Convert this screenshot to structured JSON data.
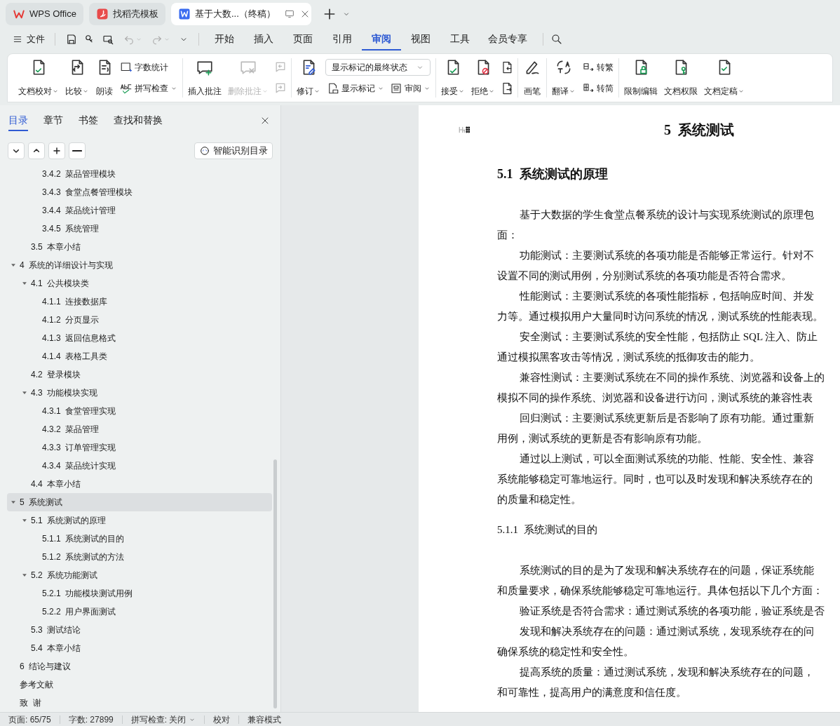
{
  "browser_tabs": [
    {
      "label": "WPS Office",
      "selected": false
    },
    {
      "label": "找稻壳模板",
      "selected": false
    },
    {
      "label": "基于大数...（终稿）",
      "selected": true
    }
  ],
  "file_menu": "文件",
  "menu_tabs": [
    {
      "label": "开始",
      "selected": false
    },
    {
      "label": "插入",
      "selected": false
    },
    {
      "label": "页面",
      "selected": false
    },
    {
      "label": "引用",
      "selected": false
    },
    {
      "label": "审阅",
      "selected": true
    },
    {
      "label": "视图",
      "selected": false
    },
    {
      "label": "工具",
      "selected": false
    },
    {
      "label": "会员专享",
      "selected": false
    }
  ],
  "ribbon": [
    {
      "items": [
        {
          "kind": "big",
          "label": "文档校对",
          "dropdown": true,
          "disabled": false
        },
        {
          "kind": "big",
          "label": "比较",
          "dropdown": true,
          "disabled": false
        },
        {
          "kind": "big",
          "label": "朗读",
          "dropdown": false,
          "disabled": false
        },
        {
          "kind": "stack",
          "rows": [
            [
              {
                "kind": "small",
                "label": "字数统计",
                "dropdown": false,
                "disabled": false
              }
            ],
            [
              {
                "kind": "small",
                "label": "拼写检查",
                "dropdown": true,
                "disabled": false
              }
            ]
          ]
        }
      ]
    },
    {
      "items": [
        {
          "kind": "big",
          "label": "插入批注",
          "dropdown": false,
          "disabled": false
        },
        {
          "kind": "big",
          "label": "删除批注",
          "dropdown": true,
          "disabled": true
        },
        {
          "kind": "stack",
          "rows": [
            [
              {
                "kind": "icon",
                "disabled": true
              }
            ],
            [
              {
                "kind": "icon",
                "disabled": true
              }
            ]
          ]
        }
      ]
    },
    {
      "items": [
        {
          "kind": "big",
          "label": "修订",
          "dropdown": true,
          "disabled": false
        },
        {
          "kind": "stack",
          "rows": [
            [
              {
                "kind": "select",
                "value": "显示标记的最终状态"
              }
            ],
            [
              {
                "kind": "small",
                "label": "显示标记",
                "dropdown": true,
                "disabled": false
              },
              {
                "kind": "small",
                "label": "审阅",
                "dropdown": true,
                "disabled": false
              }
            ]
          ]
        }
      ]
    },
    {
      "items": [
        {
          "kind": "big",
          "label": "接受",
          "dropdown": true,
          "disabled": false
        },
        {
          "kind": "big",
          "label": "拒绝",
          "dropdown": true,
          "disabled": false
        },
        {
          "kind": "stack",
          "rows": [
            [
              {
                "kind": "icon",
                "disabled": false
              }
            ],
            [
              {
                "kind": "icon",
                "disabled": false
              }
            ]
          ]
        }
      ]
    },
    {
      "items": [
        {
          "kind": "big",
          "label": "画笔",
          "dropdown": false,
          "disabled": false
        }
      ]
    },
    {
      "items": [
        {
          "kind": "big",
          "label": "翻译",
          "dropdown": true,
          "disabled": false
        },
        {
          "kind": "stack",
          "rows": [
            [
              {
                "kind": "small",
                "label": "转繁",
                "dropdown": false,
                "disabled": false
              }
            ],
            [
              {
                "kind": "small",
                "label": "转简",
                "dropdown": false,
                "disabled": false
              }
            ]
          ]
        }
      ]
    },
    {
      "items": [
        {
          "kind": "big",
          "label": "限制编辑",
          "dropdown": false,
          "disabled": false
        },
        {
          "kind": "big",
          "label": "文档权限",
          "dropdown": false,
          "disabled": false
        },
        {
          "kind": "big",
          "label": "文档定稿",
          "dropdown": true,
          "disabled": false
        }
      ]
    }
  ],
  "sidebar": {
    "tabs": [
      {
        "label": "目录",
        "selected": true
      },
      {
        "label": "章节",
        "selected": false
      },
      {
        "label": "书签",
        "selected": false
      },
      {
        "label": "查找和替换",
        "selected": false
      }
    ],
    "smart_button": "智能识别目录",
    "toc": [
      {
        "children": [
          {
            "children": [
              {
                "label": "3.4.2  菜品管理模块",
                "selected": false
              },
              {
                "label": "3.4.3  食堂点餐管理模块",
                "selected": false
              },
              {
                "label": "3.4.4  菜品统计管理",
                "selected": false
              },
              {
                "label": "3.4.5  系统管理",
                "selected": false
              }
            ]
          },
          {
            "label": "3.5  本章小结",
            "selected": false
          }
        ]
      },
      {
        "label": "4  系统的详细设计与实现",
        "selected": false,
        "expanded": true,
        "children": [
          {
            "label": "4.1  公共模块类",
            "selected": false,
            "expanded": true,
            "children": [
              {
                "label": "4.1.1  连接数据库",
                "selected": false
              },
              {
                "label": "4.1.2  分页显示",
                "selected": false
              },
              {
                "label": "4.1.3  返回信息格式",
                "selected": false
              },
              {
                "label": "4.1.4  表格工具类",
                "selected": false
              }
            ]
          },
          {
            "label": "4.2  登录模块",
            "selected": false
          },
          {
            "label": "4.3  功能模块实现",
            "selected": false,
            "expanded": true,
            "children": [
              {
                "label": "4.3.1  食堂管理实现",
                "selected": false
              },
              {
                "label": "4.3.2  菜品管理",
                "selected": false
              },
              {
                "label": "4.3.3  订单管理实现",
                "selected": false
              },
              {
                "label": "4.3.4  菜品统计实现",
                "selected": false
              }
            ]
          },
          {
            "label": "4.4  本章小结",
            "selected": false
          }
        ]
      },
      {
        "label": "5  系统测试",
        "selected": true,
        "expanded": true,
        "children": [
          {
            "label": "5.1  系统测试的原理",
            "selected": false,
            "expanded": true,
            "children": [
              {
                "label": "5.1.1  系统测试的目的",
                "selected": false
              },
              {
                "label": "5.1.2  系统测试的方法",
                "selected": false
              }
            ]
          },
          {
            "label": "5.2  系统功能测试",
            "selected": false,
            "expanded": true,
            "children": [
              {
                "label": "5.2.1  功能模块测试用例",
                "selected": false
              },
              {
                "label": "5.2.2  用户界面测试",
                "selected": false
              }
            ]
          },
          {
            "label": "5.3  测试结论",
            "selected": false
          },
          {
            "label": "5.4  本章小结",
            "selected": false
          }
        ]
      },
      {
        "label": "6  结论与建议",
        "selected": false
      },
      {
        "label": "参考文献",
        "selected": false
      },
      {
        "label": "致  谢",
        "selected": false
      }
    ]
  },
  "document": [
    {
      "kind": "heading1",
      "text": "5  系统测试"
    },
    {
      "kind": "heading2",
      "text": "5.1  系统测试的原理"
    },
    {
      "kind": "para",
      "lines": [
        "基于大数据的学生食堂点餐系统的设计与实现系统测试的原理包",
        "面："
      ]
    },
    {
      "kind": "para",
      "lines": [
        "功能测试：主要测试系统的各项功能是否能够正常运行。针对不",
        "设置不同的测试用例，分别测试系统的各项功能是否符合需求。"
      ]
    },
    {
      "kind": "para",
      "lines": [
        "性能测试：主要测试系统的各项性能指标，包括响应时间、并发",
        "力等。通过模拟用户大量同时访问系统的情况，测试系统的性能表现。"
      ]
    },
    {
      "kind": "para",
      "lines": [
        "安全测试：主要测试系统的安全性能，包括防止 SQL 注入、防止",
        "通过模拟黑客攻击等情况，测试系统的抵御攻击的能力。"
      ]
    },
    {
      "kind": "para",
      "lines": [
        "兼容性测试：主要测试系统在不同的操作系统、浏览器和设备上的",
        "模拟不同的操作系统、浏览器和设备进行访问，测试系统的兼容性表"
      ]
    },
    {
      "kind": "para",
      "lines": [
        "回归测试：主要测试系统更新后是否影响了原有功能。通过重新",
        "用例，测试系统的更新是否有影响原有功能。"
      ]
    },
    {
      "kind": "para",
      "lines": [
        "通过以上测试，可以全面测试系统的功能、性能、安全性、兼容",
        "系统能够稳定可靠地运行。同时，也可以及时发现和解决系统存在的",
        "的质量和稳定性。"
      ]
    },
    {
      "kind": "heading3",
      "text": "5.1.1  系统测试的目的"
    },
    {
      "kind": "para",
      "lines": [
        "系统测试的目的是为了发现和解决系统存在的问题，保证系统能",
        "和质量要求，确保系统能够稳定可靠地运行。具体包括以下几个方面："
      ]
    },
    {
      "kind": "para",
      "lines": [
        "验证系统是否符合需求：通过测试系统的各项功能，验证系统是否"
      ]
    },
    {
      "kind": "para",
      "lines": [
        "发现和解决系统存在的问题：通过测试系统，发现系统存在的问",
        "确保系统的稳定性和安全性。"
      ]
    },
    {
      "kind": "para",
      "lines": [
        "提高系统的质量：通过测试系统，发现和解决系统存在的问题，",
        "和可靠性，提高用户的满意度和信任度。"
      ]
    }
  ],
  "status_bar": [
    {
      "kind": "text",
      "text": "页面: 65/75"
    },
    {
      "kind": "text",
      "text": "字数: 27899"
    },
    {
      "kind": "dropdown",
      "text": "拼写检查: 关闭"
    },
    {
      "kind": "text",
      "text": "校对"
    },
    {
      "kind": "text",
      "text": "兼容模式"
    }
  ]
}
